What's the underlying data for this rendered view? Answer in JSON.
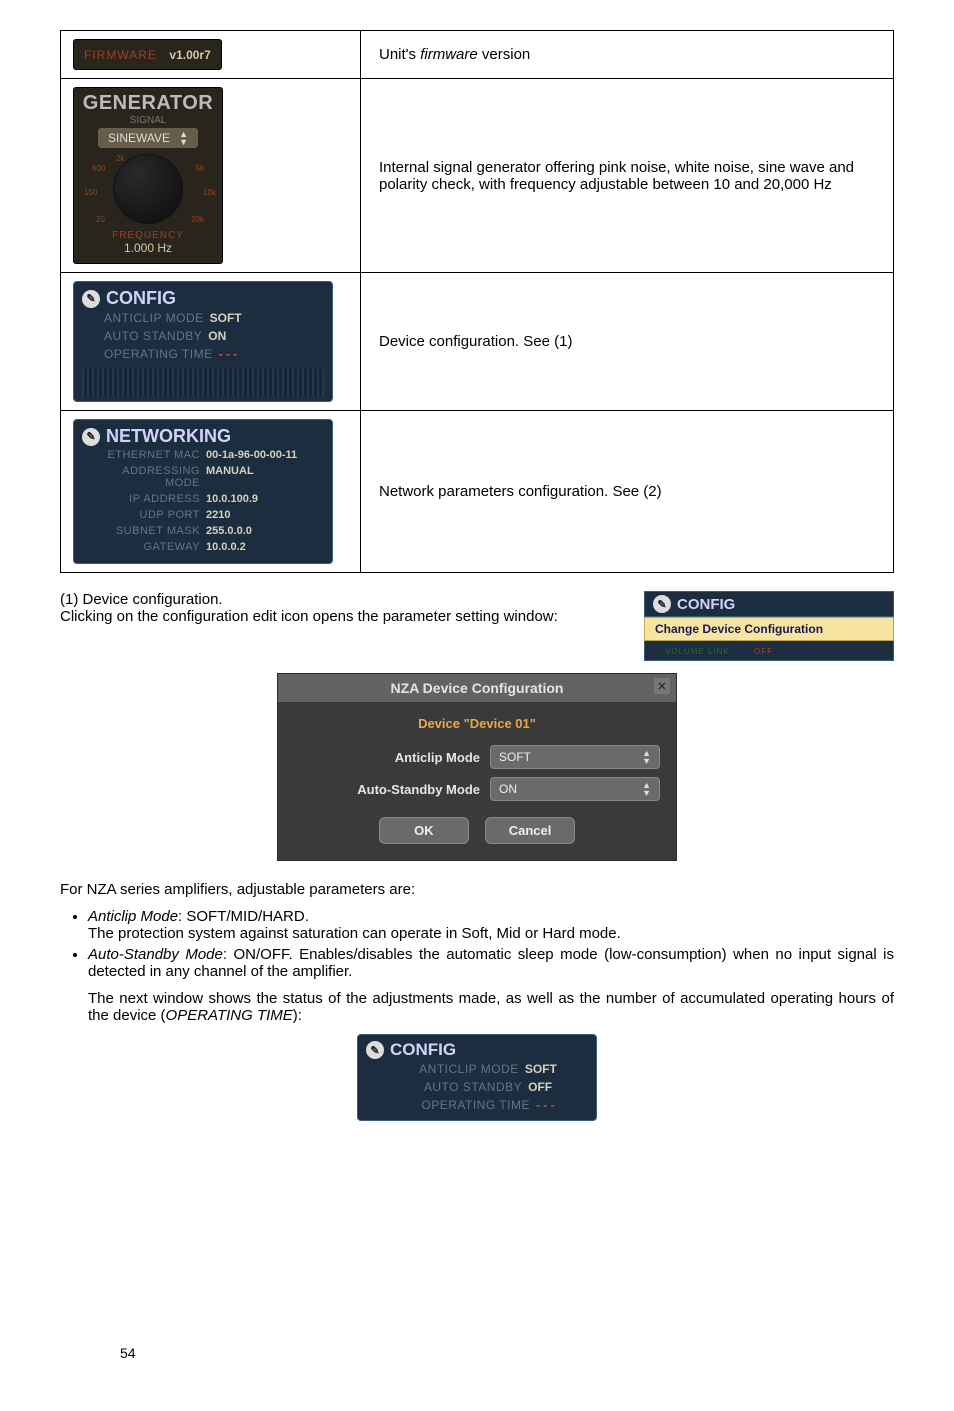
{
  "table": {
    "firmware": {
      "label": "FIRMWARE",
      "version": "v1.00r7",
      "desc_prefix": "Unit's ",
      "desc_italic": "firmware",
      "desc_suffix": " version"
    },
    "generator": {
      "title": "GENERATOR",
      "signal_label": "SIGNAL",
      "mode": "SINEWAVE",
      "ticks": {
        "t600": "600",
        "t2k": "2k",
        "t5k": "5k",
        "t150": "150",
        "t10k": "10k",
        "t20": "20",
        "t20k": "20k"
      },
      "freq_label": "FREQUENCY",
      "freq_value": "1.000 Hz",
      "desc": "Internal signal generator offering pink noise, white noise, sine wave and polarity check, with frequency adjustable between 10 and 20,000 Hz"
    },
    "config": {
      "title": "CONFIG",
      "rows": {
        "anticlip_label": "ANTICLIP MODE",
        "anticlip_value": "SOFT",
        "autostandby_label": "AUTO STANDBY",
        "autostandby_value": "ON",
        "optime_label": "OPERATING TIME",
        "optime_value": "- - -"
      },
      "desc": "Device configuration. See (1)"
    },
    "network": {
      "title": "NETWORKING",
      "rows": {
        "mac_label": "ETHERNET MAC",
        "mac_value": "00-1a-96-00-00-11",
        "addrmode_label": "ADDRESSING MODE",
        "addrmode_value": "MANUAL",
        "ip_label": "IP ADDRESS",
        "ip_value": "10.0.100.9",
        "udp_label": "UDP PORT",
        "udp_value": "2210",
        "subnet_label": "SUBNET MASK",
        "subnet_value": "255.0.0.0",
        "gateway_label": "GATEWAY",
        "gateway_value": "10.0.0.2"
      },
      "desc": "Network parameters configuration. See (2)"
    }
  },
  "section1": {
    "heading": "(1) Device configuration.",
    "text": "Clicking on the configuration edit icon opens the parameter setting window:",
    "tooltip": "Change Device Configuration",
    "tooltip_head": "CONFIG",
    "tooltip_sub_left": "VOLUME LINK",
    "tooltip_sub_right": "OFF"
  },
  "dialog": {
    "title": "NZA Device Configuration",
    "close": "✕",
    "device_label": "Device \"Device 01\"",
    "anticlip_label": "Anticlip Mode",
    "anticlip_value": "SOFT",
    "autostandby_label": "Auto-Standby Mode",
    "autostandby_value": "ON",
    "ok": "OK",
    "cancel": "Cancel"
  },
  "after_dialog": "For NZA series amplifiers, adjustable parameters are:",
  "bullets": {
    "b1_italic": "Anticlip Mode",
    "b1_rest": ": SOFT/MID/HARD.",
    "b1_line2": "The protection system against saturation can operate in Soft, Mid or Hard mode.",
    "b2_italic": "Auto-Standby Mode",
    "b2_rest": ": ON/OFF. Enables/disables the automatic sleep mode (low-consumption) when no input signal is detected in any channel of the amplifier."
  },
  "status_para_prefix": "The next window shows the status of the adjustments made, as well as the number of accumulated operating hours of the device (",
  "status_para_italic": "OPERATING TIME",
  "status_para_suffix": "):",
  "status_panel": {
    "title": "CONFIG",
    "anticlip_label": "ANTICLIP MODE",
    "anticlip_value": "SOFT",
    "autostandby_label": "AUTO STANDBY",
    "autostandby_value": "OFF",
    "optime_label": "OPERATING TIME",
    "optime_value": "- - -"
  },
  "page_number": "54"
}
